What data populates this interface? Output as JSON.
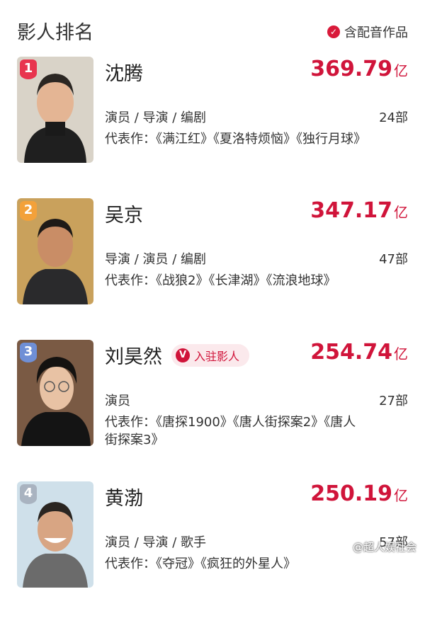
{
  "header": {
    "title": "影人排名",
    "filter_label": "含配音作品"
  },
  "ranking": [
    {
      "rank": "1",
      "name": "沈腾",
      "box_office": "369.79",
      "unit": "亿",
      "roles": "演员 / 导演 / 编剧",
      "works_count": "24部",
      "works": "代表作：《满江红》《夏洛特烦恼》《独行月球》",
      "rank_color": "#e8344e"
    },
    {
      "rank": "2",
      "name": "吴京",
      "box_office": "347.17",
      "unit": "亿",
      "roles": "导演 / 演员 / 编剧",
      "works_count": "47部",
      "works": "代表作：《战狼2》《长津湖》《流浪地球》",
      "rank_color": "#f3a13a"
    },
    {
      "rank": "3",
      "name": "刘昊然",
      "verified_label": "入驻影人",
      "box_office": "254.74",
      "unit": "亿",
      "roles": "演员",
      "works_count": "27部",
      "works": "代表作：《唐探1900》《唐人街探案2》《唐人街探案3》",
      "rank_color": "#6f8fd6"
    },
    {
      "rank": "4",
      "name": "黄渤",
      "box_office": "250.19",
      "unit": "亿",
      "roles": "演员 / 导演 / 歌手",
      "works_count": "57部",
      "works": "代表作：《夺冠》《疯狂的外星人》",
      "rank_color": "#a9b3c0"
    }
  ],
  "watermark": "@超人娱社会",
  "colors": {
    "accent": "#d0143a",
    "background": "#ffffff"
  },
  "icons": {
    "check": "check-circle-icon",
    "verified": "v-badge-icon"
  }
}
